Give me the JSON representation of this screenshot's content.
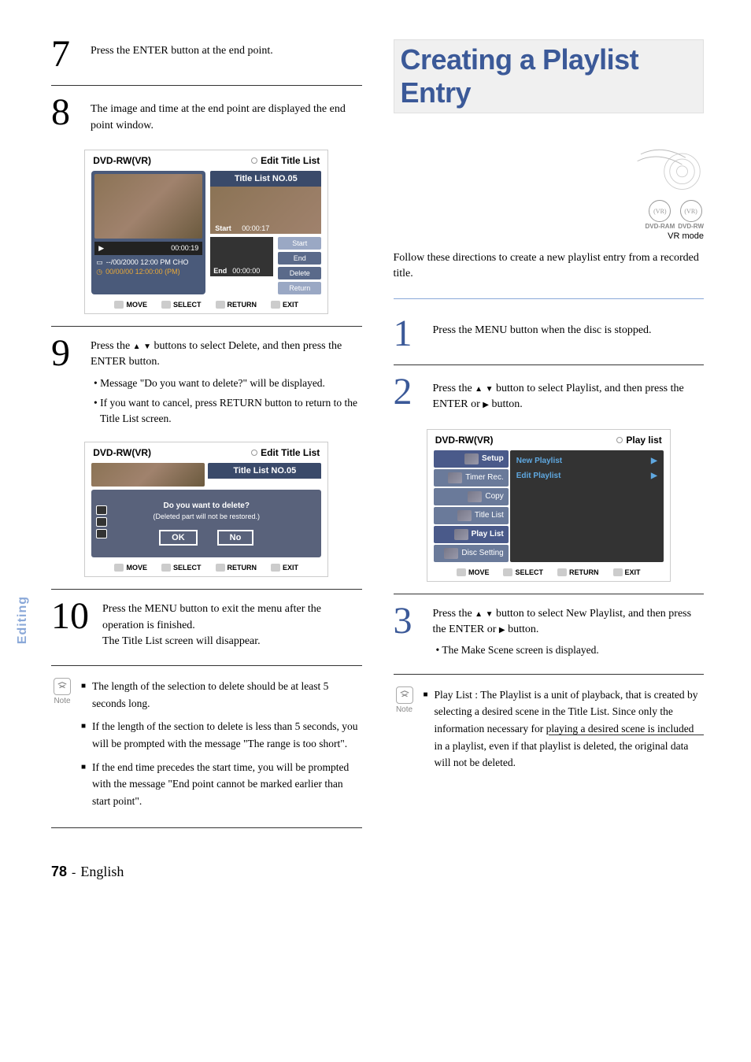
{
  "left": {
    "step7": {
      "text": "Press the ENTER button at the end point."
    },
    "step8": {
      "text": "The image and time at the end point are displayed the end point window."
    },
    "osd1": {
      "headerLeft": "DVD-RW(VR)",
      "headerRight": "Edit Title List",
      "titleNo": "Title List NO.05",
      "playTime": "00:00:19",
      "meta1": "--/00/2000 12:00 PM CHO",
      "meta2": "00/00/00 12:00:00 (PM)",
      "startLabel": "Start",
      "startTime": "00:00:17",
      "endLabel": "End",
      "endTime": "00:00:00",
      "btnStart": "Start",
      "btnEnd": "End",
      "btnDelete": "Delete",
      "btnReturn": "Return",
      "footMove": "MOVE",
      "footSelect": "SELECT",
      "footReturn": "RETURN",
      "footExit": "EXIT"
    },
    "step9": {
      "text": "Press the ▲▼ buttons to select Delete, and then press the ENTER button.",
      "b1": "Message \"Do you want to delete?\" will be displayed.",
      "b2": "If you want to cancel, press RETURN button to return to the Title List screen."
    },
    "osd2": {
      "headerLeft": "DVD-RW(VR)",
      "headerRight": "Edit Title List",
      "titleNo": "Title List NO.05",
      "msg1": "Do you want to delete?",
      "msg2": "(Deleted part will not be restored.)",
      "ok": "OK",
      "no": "No",
      "footMove": "MOVE",
      "footSelect": "SELECT",
      "footReturn": "RETURN",
      "footExit": "EXIT"
    },
    "step10": {
      "text1": "Press the MENU button to exit the menu after the operation is finished.",
      "text2": "The Title List screen will disappear."
    },
    "notes": {
      "n1": "The length of the selection to delete should be at least 5 seconds long.",
      "n2": "If the length of the section to delete is less than 5 seconds, you will be prompted with the message \"The range is too short\".",
      "n3": "If the end time precedes the start time, you will be prompted with the message \"End point cannot be marked earlier than start point\"."
    }
  },
  "right": {
    "heading": "Creating a Playlist Entry",
    "disc1": "DVD-RAM",
    "disc2": "DVD-RW",
    "vrmode": "VR mode",
    "intro": "Follow these directions to create a new playlist entry from a recorded title.",
    "step1": "Press the MENU button when the disc is stopped.",
    "step2": "Press the ▲▼ button to select Playlist, and then press the ENTER or ▶ button.",
    "osd3": {
      "headerLeft": "DVD-RW(VR)",
      "headerRight": "Play list",
      "m1": "Setup",
      "m2": "Timer Rec.",
      "m3": "Copy",
      "m4": "Title List",
      "m5": "Play List",
      "m6": "Disc Setting",
      "r1": "New Playlist",
      "r2": "Edit Playlist",
      "footMove": "MOVE",
      "footSelect": "SELECT",
      "footReturn": "RETURN",
      "footExit": "EXIT"
    },
    "step3": {
      "text": "Press the ▲▼ button to select New Playlist, and then press the ENTER or ▶ button.",
      "b1": "The Make Scene screen is displayed."
    },
    "note": {
      "label": "Play List : ",
      "text": "The Playlist is a unit of playback, that is created by selecting a desired scene in the Title List. Since only the information necessary for playing a desired scene is included in a playlist, even if that playlist is deleted, the original data will not be deleted."
    }
  },
  "sideTab": "Editing",
  "footer": {
    "pageNum": "78",
    "dash": "-",
    "lang": "English"
  },
  "noteLabel": "Note"
}
